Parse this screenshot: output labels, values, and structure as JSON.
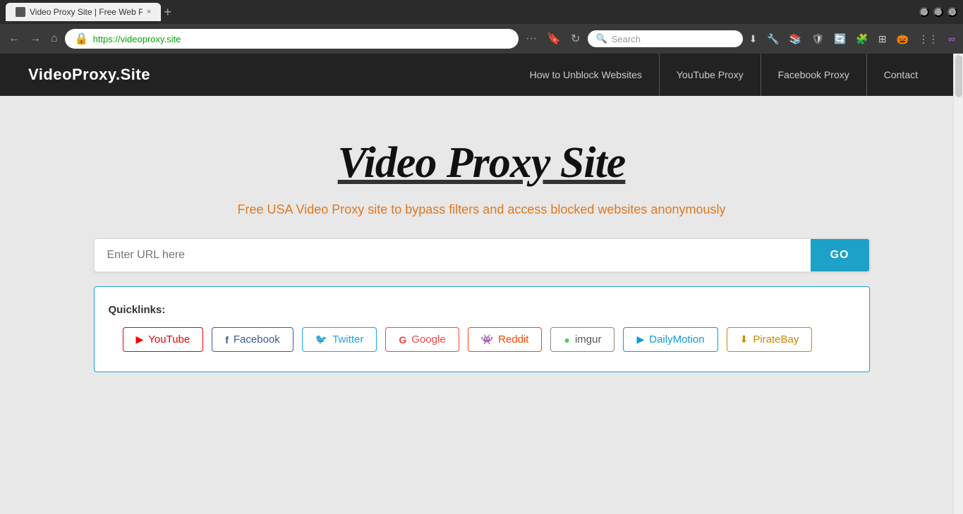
{
  "browser": {
    "tab_title": "Video Proxy Site | Free Web Proxy t...",
    "tab_close": "×",
    "tab_new": "+",
    "url": "https://videoproxy.site",
    "url_display": "https://videoproxy.site",
    "search_placeholder": "Search",
    "win_min": "−",
    "win_max": "□",
    "win_close": "×",
    "nav_back": "←",
    "nav_forward": "→",
    "nav_home": "⌂",
    "nav_refresh": "↻",
    "nav_more": "···"
  },
  "site": {
    "logo": "VideoProxy.Site",
    "nav": [
      {
        "label": "How to Unblock Websites"
      },
      {
        "label": "YouTube Proxy"
      },
      {
        "label": "Facebook Proxy"
      },
      {
        "label": "Contact"
      }
    ]
  },
  "main": {
    "title": "Video Proxy Site",
    "subtitle": "Free USA Video Proxy site to bypass filters and access blocked websites anonymously",
    "url_placeholder": "Enter URL here",
    "go_button": "GO",
    "quicklinks_label": "Quicklinks:",
    "quicklinks": [
      {
        "id": "youtube",
        "icon": "▶",
        "label": "YouTube",
        "class": "ql-youtube"
      },
      {
        "id": "facebook",
        "icon": "f",
        "label": "Facebook",
        "class": "ql-facebook"
      },
      {
        "id": "twitter",
        "icon": "🐦",
        "label": "Twitter",
        "class": "ql-twitter"
      },
      {
        "id": "google",
        "icon": "G",
        "label": "Google",
        "class": "ql-google"
      },
      {
        "id": "reddit",
        "icon": "👾",
        "label": "Reddit",
        "class": "ql-reddit"
      },
      {
        "id": "imgur",
        "icon": "●",
        "label": "imgur",
        "class": "ql-imgur"
      },
      {
        "id": "dailymotion",
        "icon": "▶",
        "label": "DailyMotion",
        "class": "ql-dailymotion"
      },
      {
        "id": "piratebay",
        "icon": "⬇",
        "label": "PirateBay",
        "class": "ql-piratebay"
      }
    ]
  }
}
